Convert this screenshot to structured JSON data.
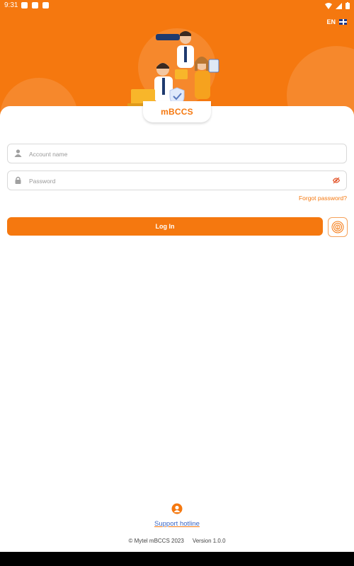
{
  "status_bar": {
    "time": "9:31",
    "left_icons": [
      "play-icon",
      "sim-icon",
      "notification-icon"
    ],
    "right_icons": [
      "wifi-icon",
      "signal-icon",
      "battery-icon"
    ]
  },
  "language": {
    "code": "EN",
    "flag": "uk-flag-icon"
  },
  "brand": {
    "logo_text": "mBCCS",
    "accent": "#f5780f"
  },
  "form": {
    "account_placeholder": "Account name",
    "account_value": "",
    "password_placeholder": "Password",
    "password_value": "",
    "forgot_label": "Forgot password?",
    "login_label": "Log In"
  },
  "support": {
    "label": "Support hotline"
  },
  "footer": {
    "copyright": "© Mytel mBCCS 2023",
    "version": "Version 1.0.0"
  }
}
